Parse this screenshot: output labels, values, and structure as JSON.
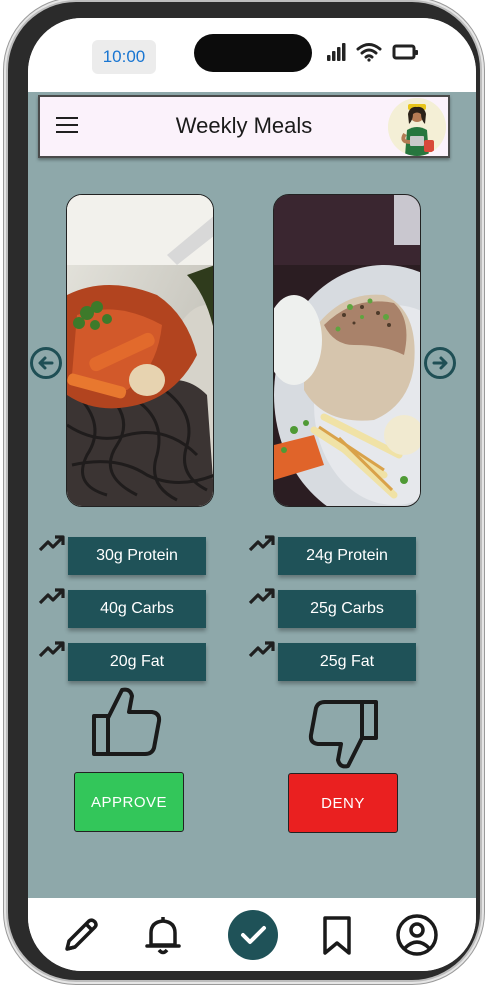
{
  "status_bar": {
    "time": "10:00"
  },
  "app_bar": {
    "title": "Weekly Meals"
  },
  "meals": [
    {
      "protein": "30g Protein",
      "carbs": "40g Carbs",
      "fat": "20g Fat"
    },
    {
      "protein": "24g Protein",
      "carbs": "25g Carbs",
      "fat": "25g Fat"
    }
  ],
  "actions": {
    "approve": "APPROVE",
    "deny": "DENY"
  },
  "colors": {
    "screen_bg": "#8ea8aa",
    "chip_bg": "#1f5258",
    "approve": "#33c65a",
    "deny": "#ea2020",
    "app_bar_bg": "#fbf2fb"
  },
  "bottom_nav": {
    "icons": [
      "pencil-icon",
      "bell-icon",
      "check-icon",
      "bookmark-icon",
      "account-icon"
    ],
    "active": "check-icon"
  }
}
